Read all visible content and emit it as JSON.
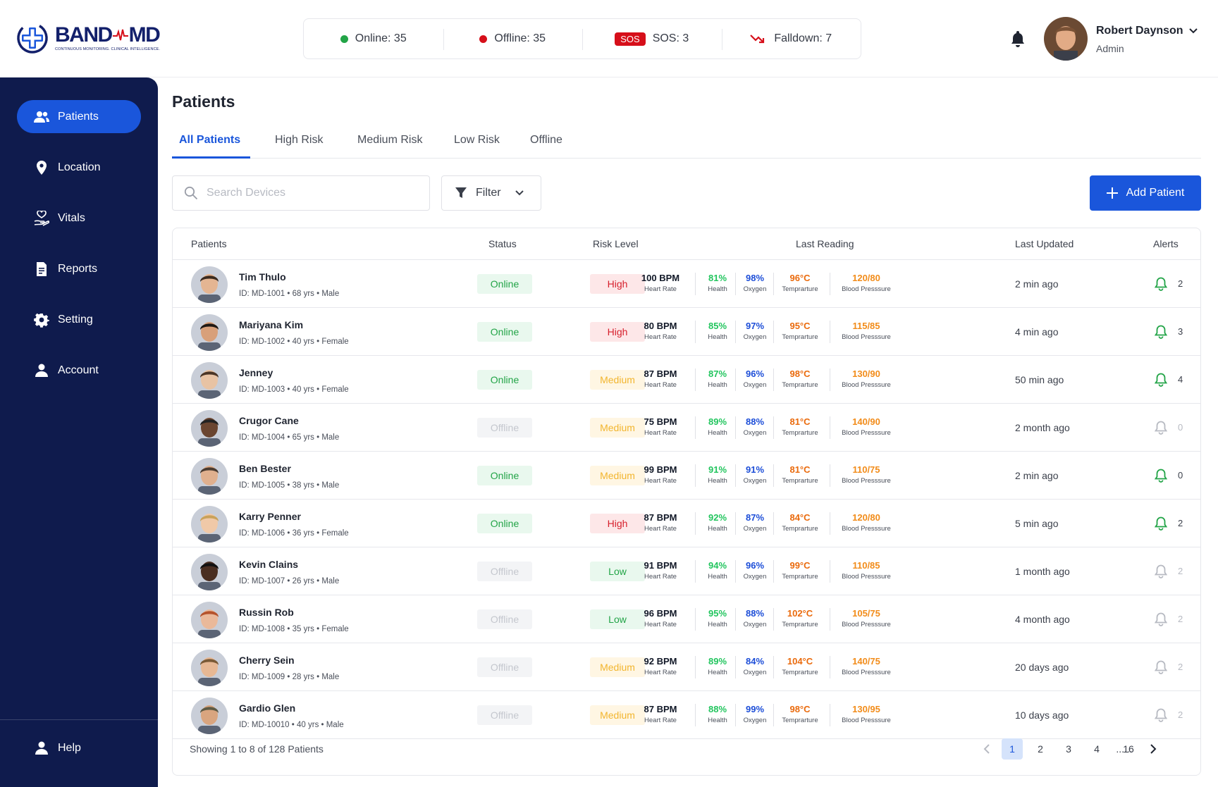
{
  "header": {
    "logo": {
      "word_left": "BAND",
      "word_right": "MD",
      "tagline": "CONTINUOUS MONITORING. CLINICAL INTELLIGENCE."
    },
    "stats": {
      "online": "Online: 35",
      "offline": "Offline: 35",
      "sos_badge": "SOS",
      "sos": "SOS: 3",
      "falldown": "Falldown: 7"
    },
    "user": {
      "name": "Robert Daynson",
      "role": "Admin"
    }
  },
  "sidebar": {
    "items": [
      {
        "label": "Patients",
        "icon": "users-icon"
      },
      {
        "label": "Location",
        "icon": "location-pin-icon"
      },
      {
        "label": "Vitals",
        "icon": "vitals-hand-heart-icon"
      },
      {
        "label": "Reports",
        "icon": "document-icon"
      },
      {
        "label": "Setting",
        "icon": "gear-icon"
      },
      {
        "label": "Account",
        "icon": "user-icon"
      }
    ],
    "help": "Help"
  },
  "main": {
    "title": "Patients",
    "tabs": [
      "All Patients",
      "High Risk",
      "Medium Risk",
      "Low Risk",
      "Offline"
    ],
    "search_placeholder": "Search Devices",
    "filter_label": "Filter",
    "add_label": "Add Patient"
  },
  "table": {
    "columns": [
      "Patients",
      "Status",
      "Risk Level",
      "Last Reading",
      "Last Updated",
      "Alerts"
    ],
    "reading_labels": [
      "Heart Rate",
      "Health",
      "Oxygen",
      "Temprarture",
      "Blood Presssure"
    ],
    "rows": [
      {
        "name": "Tim Thulo",
        "meta": "ID: MD-1001 • 68 yrs • Male",
        "status": "Online",
        "risk": "High",
        "hr": "100 BPM",
        "health": "81%",
        "oxygen": "98%",
        "temp": "96°C",
        "bp": "120/80",
        "updated": "2 min ago",
        "alerts": "2"
      },
      {
        "name": "Mariyana Kim",
        "meta": "ID: MD-1002 • 40 yrs • Female",
        "status": "Online",
        "risk": "High",
        "hr": "80 BPM",
        "health": "85%",
        "oxygen": "97%",
        "temp": "95°C",
        "bp": "115/85",
        "updated": "4 min ago",
        "alerts": "3"
      },
      {
        "name": "Jenney",
        "meta": "ID: MD-1003 • 40 yrs • Female",
        "status": "Online",
        "risk": "Medium",
        "hr": "87 BPM",
        "health": "87%",
        "oxygen": "96%",
        "temp": "98°C",
        "bp": "130/90",
        "updated": "50 min ago",
        "alerts": "4"
      },
      {
        "name": "Crugor Cane",
        "meta": "ID: MD-1004 • 65 yrs • Male",
        "status": "Offline",
        "risk": "Medium",
        "hr": "75 BPM",
        "health": "89%",
        "oxygen": "88%",
        "temp": "81°C",
        "bp": "140/90",
        "updated": "2 month ago",
        "alerts": "0"
      },
      {
        "name": "Ben Bester",
        "meta": "ID: MD-1005 • 38 yrs • Male",
        "status": "Online",
        "risk": "Medium",
        "hr": "99 BPM",
        "health": "91%",
        "oxygen": "91%",
        "temp": "81°C",
        "bp": "110/75",
        "updated": "2 min ago",
        "alerts": "0"
      },
      {
        "name": "Karry Penner",
        "meta": "ID: MD-1006 • 36 yrs • Female",
        "status": "Online",
        "risk": "High",
        "hr": "87 BPM",
        "health": "92%",
        "oxygen": "87%",
        "temp": "84°C",
        "bp": "120/80",
        "updated": "5 min ago",
        "alerts": "2"
      },
      {
        "name": "Kevin Clains",
        "meta": "ID: MD-1007 • 26 yrs • Male",
        "status": "Offline",
        "risk": "Low",
        "hr": "91 BPM",
        "health": "94%",
        "oxygen": "96%",
        "temp": "99°C",
        "bp": "110/85",
        "updated": "1 month ago",
        "alerts": "2"
      },
      {
        "name": "Russin Rob",
        "meta": "ID: MD-1008 • 35 yrs • Female",
        "status": "Offline",
        "risk": "Low",
        "hr": "96 BPM",
        "health": "95%",
        "oxygen": "88%",
        "temp": "102°C",
        "bp": "105/75",
        "updated": "4 month ago",
        "alerts": "2"
      },
      {
        "name": "Cherry Sein",
        "meta": "ID: MD-1009 • 28 yrs • Male",
        "status": "Offline",
        "risk": "Medium",
        "hr": "92 BPM",
        "health": "89%",
        "oxygen": "84%",
        "temp": "104°C",
        "bp": "140/75",
        "updated": "20 days ago",
        "alerts": "2"
      },
      {
        "name": "Gardio Glen",
        "meta": "ID: MD-10010 • 40 yrs • Male",
        "status": "Offline",
        "risk": "Medium",
        "hr": "87 BPM",
        "health": "88%",
        "oxygen": "99%",
        "temp": "98°C",
        "bp": "130/95",
        "updated": "10 days ago",
        "alerts": "2"
      }
    ],
    "footer": {
      "showing": "Showing 1 to 8 of 128 Patients",
      "pages": [
        "1",
        "2",
        "3",
        "4",
        "......",
        "16"
      ],
      "current_page": "1"
    }
  },
  "colors": {
    "brand_navy": "#0f1b4d",
    "accent_blue": "#1a56db",
    "online_green": "#22a447",
    "offline_red": "#d60f1a",
    "health_green": "#22c55e",
    "oxygen_blue": "#1d4ed8",
    "temp_orange": "#ea6a0c",
    "bp_orange": "#f28c1a"
  }
}
